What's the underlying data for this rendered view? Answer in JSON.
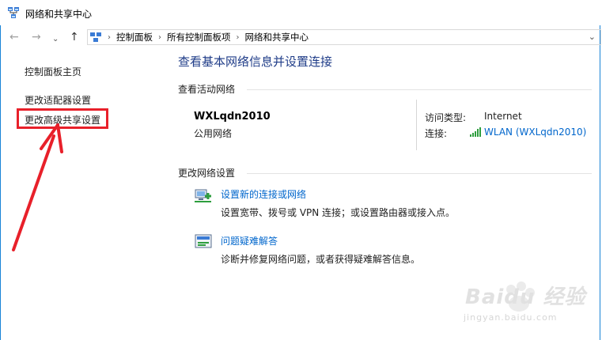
{
  "window": {
    "title": "网络和共享中心"
  },
  "address_bar": {
    "breadcrumbs": [
      "控制面板",
      "所有控制面板项",
      "网络和共享中心"
    ]
  },
  "sidebar": {
    "items": [
      {
        "label": "控制面板主页"
      },
      {
        "label": "更改适配器设置"
      },
      {
        "label": "更改高级共享设置"
      }
    ]
  },
  "main": {
    "title": "查看基本网络信息并设置连接",
    "active_section": "查看活动网络",
    "network": {
      "name": "WXLqdn2010",
      "category": "公用网络",
      "access_type_label": "访问类型:",
      "access_type_value": "Internet",
      "connection_label": "连接:",
      "connection_value": "WLAN (WXLqdn2010)"
    },
    "change_section": "更改网络设置",
    "tasks": [
      {
        "link": "设置新的连接或网络",
        "desc": "设置宽带、拨号或 VPN 连接；或设置路由器或接入点。"
      },
      {
        "link": "问题疑难解答",
        "desc": "诊断并修复网络问题，或者获得疑难解答信息。"
      }
    ]
  },
  "watermark": {
    "brand": "Baidu 经验",
    "url": "jingyan.baidu.com"
  },
  "colors": {
    "link": "#0066cc",
    "title": "#1f3c88",
    "highlight": "#e8202a",
    "window_border": "#1883d7"
  }
}
